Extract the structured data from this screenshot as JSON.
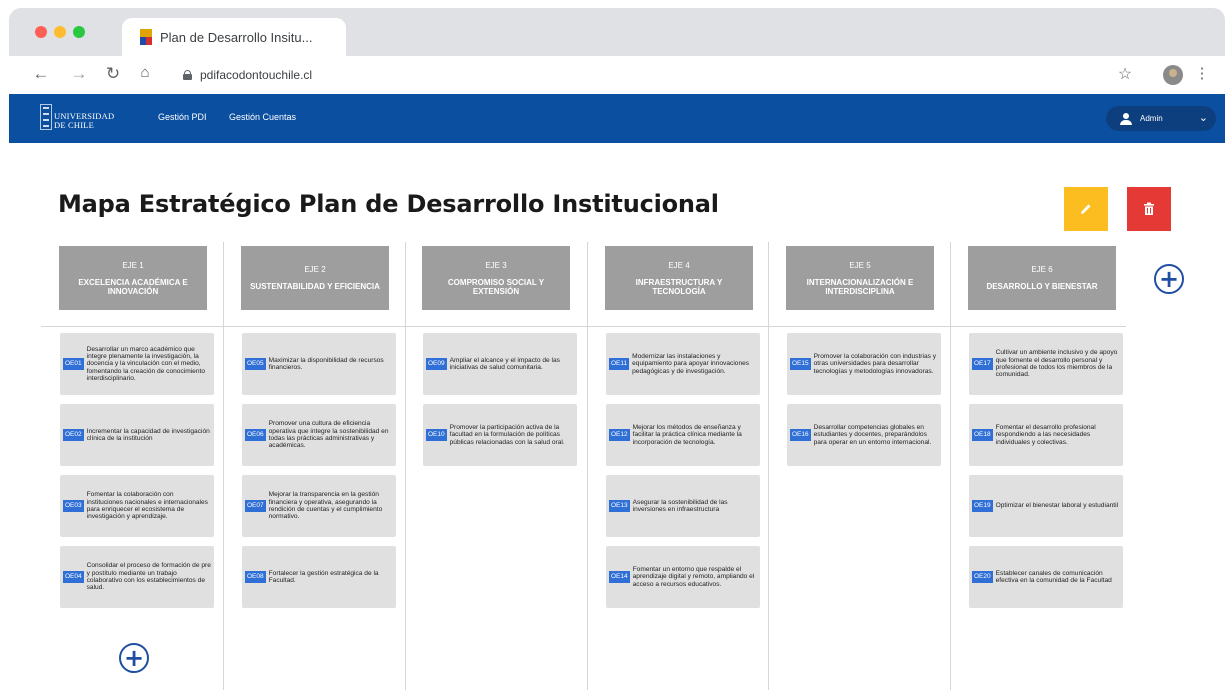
{
  "browser": {
    "tab_title": "Plan de Desarrollo Insitu...",
    "url": "pdifacodontouchile.cl"
  },
  "app": {
    "logo_line1": "UNIVERSIDAD",
    "logo_line2": "DE CHILE",
    "nav": [
      "Gestión PDI",
      "Gestión Cuentas"
    ],
    "user": "Admin"
  },
  "page": {
    "title": "Mapa Estratégico Plan de Desarrollo Institucional"
  },
  "colors": {
    "appbar": "#0b4fa0",
    "edit": "#fbbd1f",
    "delete": "#e53935",
    "axis": "#9e9e9e",
    "code": "#2f6fd6"
  },
  "axes": [
    {
      "num": "EJE 1",
      "name": "EXCELENCIA ACADÉMICA E INNOVACIÓN",
      "objectives": [
        {
          "code": "OE01",
          "text": "Desarrollar un marco académico que integre plenamente la investigación, la docencia y la vinculación con el medio, fomentando la creación de conocimiento interdisciplinario."
        },
        {
          "code": "OE02",
          "text": "Incrementar la capacidad de investigación clínica de la institución"
        },
        {
          "code": "OE03",
          "text": "Fomentar la colaboración con instituciones nacionales e internacionales para enriquecer el ecosistema de investigación y aprendizaje."
        },
        {
          "code": "OE04",
          "text": "Consolidar el proceso de formación de pre y postítulo mediante un trabajo colaborativo con los establecimientos de salud."
        }
      ]
    },
    {
      "num": "EJE 2",
      "name": "SUSTENTABILIDAD Y EFICIENCIA",
      "objectives": [
        {
          "code": "OE05",
          "text": "Maximizar la disponibilidad de recursos financieros."
        },
        {
          "code": "OE06",
          "text": "Promover una cultura de eficiencia operativa que integre la sostenibilidad en todas las prácticas administrativas y académicas."
        },
        {
          "code": "OE07",
          "text": "Mejorar la transparencia en la gestión financiera y operativa, asegurando la rendición de cuentas y el cumplimiento normativo."
        },
        {
          "code": "OE08",
          "text": "Fortalecer la gestión estratégica de la Facultad."
        }
      ]
    },
    {
      "num": "EJE 3",
      "name": "COMPROMISO SOCIAL Y EXTENSIÓN",
      "objectives": [
        {
          "code": "OE09",
          "text": "Ampliar el alcance y el impacto de las iniciativas de salud comunitaria."
        },
        {
          "code": "OE10",
          "text": "Promover la participación activa de la facultad en la formulación de políticas públicas relacionadas con la salud oral."
        }
      ]
    },
    {
      "num": "EJE 4",
      "name": "INFRAESTRUCTURA Y TECNOLOGÍA",
      "objectives": [
        {
          "code": "OE11",
          "text": "Modernizar las instalaciones y equipamiento para apoyar innovaciones pedagógicas y de investigación."
        },
        {
          "code": "OE12",
          "text": "Mejorar los métodos de enseñanza y facilitar la práctica clínica mediante la incorporación de tecnología."
        },
        {
          "code": "OE13",
          "text": "Asegurar la sostenibilidad de las inversiones en infraestructura"
        },
        {
          "code": "OE14",
          "text": "Fomentar un entorno que respalde el aprendizaje digital y remoto, ampliando el acceso a recursos educativos."
        }
      ]
    },
    {
      "num": "EJE 5",
      "name": "INTERNACIONALIZACIÓN E INTERDISCIPLINA",
      "objectives": [
        {
          "code": "OE15",
          "text": "Promover la colaboración con industrias y otras universidades para desarrollar tecnologías y metodologías innovadoras."
        },
        {
          "code": "OE16",
          "text": "Desarrollar competencias globales en estudiantes y docentes, preparándolos para operar en un entorno internacional."
        }
      ]
    },
    {
      "num": "EJE 6",
      "name": "DESARROLLO Y BIENESTAR",
      "objectives": [
        {
          "code": "OE17",
          "text": "Cultivar un ambiente inclusivo y de apoyo que fomente el desarrollo personal y profesional de todos los miembros de la comunidad."
        },
        {
          "code": "OE18",
          "text": "Fomentar el desarrollo profesional respondiendo a las necesidades individuales y colectivas."
        },
        {
          "code": "OE19",
          "text": "Optimizar el bienestar laboral y estudiantil"
        },
        {
          "code": "OE20",
          "text": "Establecer canales de comunicación efectiva en la comunidad de la Facultad"
        }
      ]
    }
  ]
}
